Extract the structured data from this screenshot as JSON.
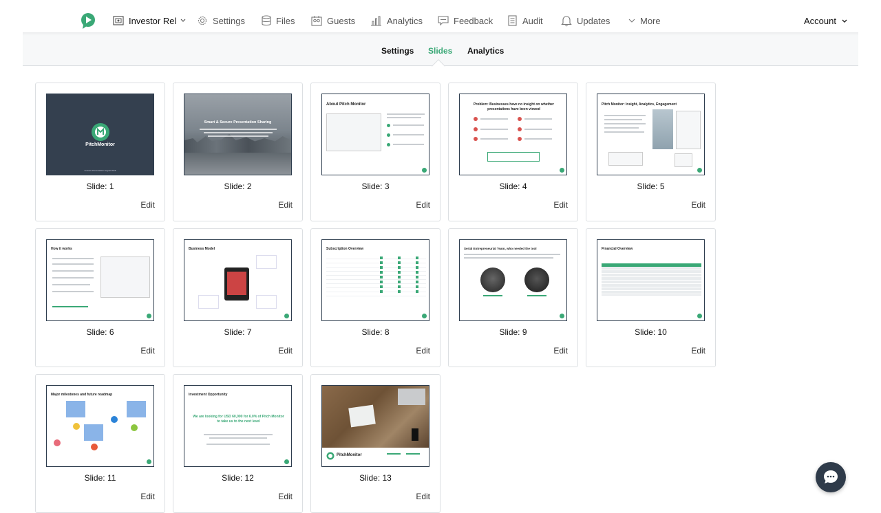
{
  "nav": {
    "workspace": "Investor Rel",
    "items": [
      "Settings",
      "Files",
      "Guests",
      "Analytics",
      "Feedback",
      "Audit",
      "Updates",
      "More"
    ],
    "account": "Account"
  },
  "subtabs": [
    "Settings",
    "Slides",
    "Analytics"
  ],
  "active_subtab": "Slides",
  "slides": [
    {
      "label": "Slide: 1",
      "edit": "Edit",
      "thumb_title": "PitchMonitor",
      "thumb_footer": "Investor Presentation August 2016"
    },
    {
      "label": "Slide: 2",
      "edit": "Edit",
      "thumb_title": "Smart & Secure Presentation Sharing"
    },
    {
      "label": "Slide: 3",
      "edit": "Edit",
      "thumb_title": "About Pitch Monitor"
    },
    {
      "label": "Slide: 4",
      "edit": "Edit",
      "thumb_title": "Problem: Businesses have no insight on whether presentations have been viewed"
    },
    {
      "label": "Slide: 5",
      "edit": "Edit",
      "thumb_title": "Pitch Monitor: Insight, Analytics, Engagement"
    },
    {
      "label": "Slide: 6",
      "edit": "Edit",
      "thumb_title": "How it works"
    },
    {
      "label": "Slide: 7",
      "edit": "Edit",
      "thumb_title": "Business Model"
    },
    {
      "label": "Slide: 8",
      "edit": "Edit",
      "thumb_title": "Subscription Overview"
    },
    {
      "label": "Slide: 9",
      "edit": "Edit",
      "thumb_title": "Serial Entrepreneurial Team, who needed the tool"
    },
    {
      "label": "Slide: 10",
      "edit": "Edit",
      "thumb_title": "Financial Overview"
    },
    {
      "label": "Slide: 11",
      "edit": "Edit",
      "thumb_title": "Major milestones and future roadmap"
    },
    {
      "label": "Slide: 12",
      "edit": "Edit",
      "thumb_title": "Investment Opportunity",
      "thumb_body": "We are looking for USD 60,000 for 6.0% of Pitch Monitor to take us to the next level"
    },
    {
      "label": "Slide: 13",
      "edit": "Edit",
      "thumb_title": "PitchMonitor"
    }
  ],
  "colors": {
    "accent": "#3aa876",
    "dark": "#2e3d4e"
  }
}
